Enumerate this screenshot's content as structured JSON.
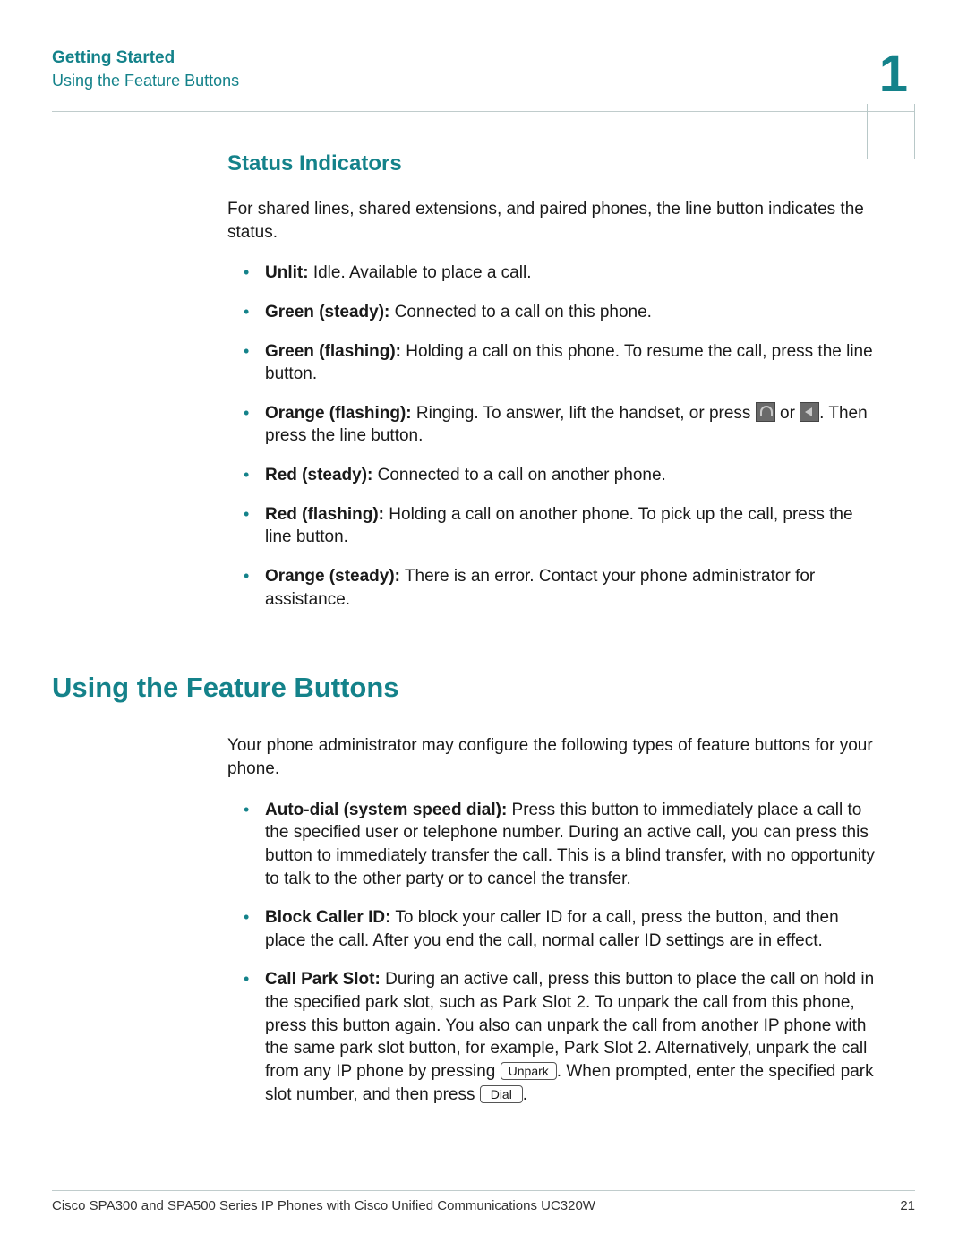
{
  "header": {
    "chapter_title": "Getting Started",
    "breadcrumb": "Using the Feature Buttons",
    "chapter_number": "1"
  },
  "status_indicators": {
    "heading": "Status Indicators",
    "intro": "For shared lines, shared extensions, and paired phones, the line button indicates the status.",
    "items": [
      {
        "label": "Unlit:",
        "text": " Idle. Available to place a call."
      },
      {
        "label": "Green (steady):",
        "text": " Connected to a call on this phone."
      },
      {
        "label": "Green (flashing):",
        "text": " Holding a call on this phone. To resume the call, press the line button."
      },
      {
        "label": "Orange (flashing):",
        "text_a": " Ringing. To answer, lift the handset, or press ",
        "text_b": " or ",
        "text_c": ". Then press the line button."
      },
      {
        "label": "Red (steady):",
        "text": " Connected to a call on another phone."
      },
      {
        "label": "Red (flashing):",
        "text": " Holding a call on another phone. To pick up the call, press the line button."
      },
      {
        "label": "Orange (steady):",
        "text": " There is an error. Contact your phone administrator for assistance."
      }
    ]
  },
  "feature_buttons": {
    "heading": "Using the Feature Buttons",
    "intro": "Your phone administrator may configure the following types of feature buttons for your phone.",
    "items": [
      {
        "label": "Auto-dial (system speed dial):",
        "text": " Press this button to immediately place a call to the specified user or telephone number. During an active call, you can press this button to immediately transfer the call. This is a blind transfer, with no opportunity to talk to the other party or to cancel the transfer."
      },
      {
        "label": "Block Caller ID:",
        "text": " To block your caller ID for a call, press the button, and then place the call. After you end the call, normal caller ID settings are in effect."
      },
      {
        "label": "Call Park Slot:",
        "text_a": " During an active call, press this button to place the call on hold in the specified park slot, such as Park Slot 2. To unpark the call from this phone, press this button again. You also can unpark the call from another IP phone with the same park slot button, for example, Park Slot 2. Alternatively, unpark the call from any IP phone by pressing ",
        "softkey1": "Unpark",
        "text_b": ". When prompted, enter the specified park slot number, and then press ",
        "softkey2": "Dial",
        "text_c": "."
      }
    ]
  },
  "footer": {
    "left": "Cisco SPA300 and SPA500 Series IP Phones with Cisco Unified Communications UC320W",
    "right": "21"
  }
}
